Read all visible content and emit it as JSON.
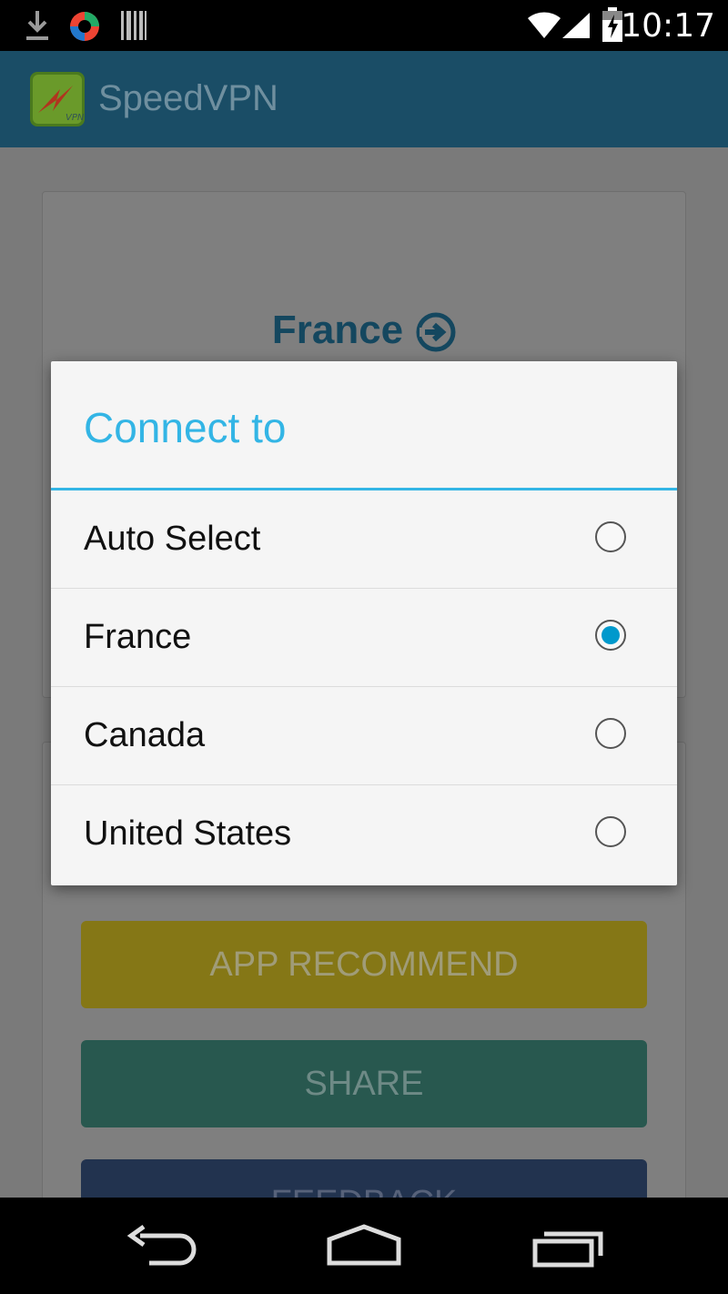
{
  "status_bar": {
    "time": "10:17",
    "icons": [
      "download-icon",
      "app-notification-icon",
      "barcode-icon",
      "wifi-icon",
      "signal-icon",
      "battery-icon"
    ]
  },
  "app": {
    "title": "SpeedVPN",
    "logo_text": "VPN"
  },
  "background": {
    "selected_server": "France",
    "buttons": {
      "recommend": "APP RECOMMEND",
      "share": "SHARE",
      "feedback": "FEEDBACK"
    }
  },
  "dialog": {
    "title": "Connect to",
    "options": [
      {
        "label": "Auto Select",
        "checked": false
      },
      {
        "label": "France",
        "checked": true
      },
      {
        "label": "Canada",
        "checked": false
      },
      {
        "label": "United States",
        "checked": false
      }
    ]
  },
  "colors": {
    "accent": "#33b5e5",
    "radio_fill": "#0099cc",
    "action_bar": "#1a4d66"
  }
}
